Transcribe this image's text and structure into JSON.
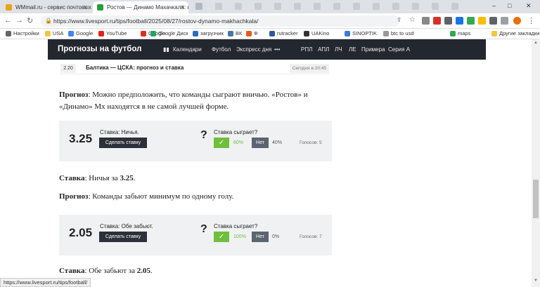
{
  "tabs": [
    {
      "title": "WMmail.ru - сервис почтовых ре",
      "color": "#e8a317"
    },
    {
      "title": "Ростов — Динамо Махачкала: пр",
      "color": "#2a9d3b"
    }
  ],
  "window_controls": [
    "–",
    "□",
    "✕"
  ],
  "address_bar": {
    "url": "https://www.livesport.ru/tips/football/2025/08/27/rostov-dynamo-makhachkala/"
  },
  "bookmarks": [
    {
      "label": "Настройки",
      "color": "#666"
    },
    {
      "label": "USA",
      "color": "#f4c542"
    },
    {
      "label": "Google",
      "color": "#4285f4"
    },
    {
      "label": "YouTube",
      "color": "#e62117"
    },
    {
      "label": "Google",
      "color": "#d93025"
    },
    {
      "label": "Google Диск",
      "color": "#1fa463"
    },
    {
      "label": "загрузчик",
      "color": "#2d6bc4"
    },
    {
      "label": "ВК",
      "color": "#4a76a8"
    },
    {
      "label": "Ф",
      "color": "#e45b1e"
    },
    {
      "label": "rutracker",
      "color": "#2c5aa0"
    },
    {
      "label": "UAKino",
      "color": "#333"
    },
    {
      "label": "SINOPTIK",
      "color": "#3a7bd5"
    },
    {
      "label": "btc to usd",
      "color": "#999"
    },
    {
      "label": "maps",
      "color": "#34a853"
    },
    {
      "label": "Другие закладки",
      "color": "#f4c542"
    }
  ],
  "header": {
    "logo": "Прогнозы на футбол",
    "nav": [
      "Календари",
      "Футбол",
      "Экспресс дня",
      "•••",
      "РПЛ",
      "АПЛ",
      "ЛЧ",
      "ЛЕ",
      "Примера",
      "Серия А"
    ]
  },
  "match": {
    "number": "2.20",
    "title": "Балтика — ЦСКА: прогноз и ставка",
    "time": "Сегодня в 20:45"
  },
  "para1": {
    "label": "Прогноз",
    "text": ": Можно предположить, что команды сыграют вничью. «Ростов» и «Динамо» Мх находятся в не самой лучшей форме."
  },
  "card1": {
    "odds": "3.25",
    "bet_label": "Ставка: Ничья.",
    "button": "Сделать ставку",
    "question": "?",
    "will_label": "Ставка сыграет?",
    "yes_icon": "✓",
    "yes_pct": "60%",
    "no_label": "Нет",
    "no_pct": "40%",
    "votes": "Голосов: 5"
  },
  "bet1": {
    "label": "Ставка",
    "text": ": Ничья за ",
    "value": "3.25",
    "end": "."
  },
  "para2": {
    "label": "Прогноз",
    "text": ": Команды забьют минимум по одному голу."
  },
  "card2": {
    "odds": "2.05",
    "bet_label": "Ставка: Обе забьют.",
    "button": "Сделать ставку",
    "question": "?",
    "will_label": "Ставка сыграет?",
    "yes_icon": "✓",
    "yes_pct": "100%",
    "no_label": "Нет",
    "no_pct": "0%",
    "votes": "Голосов: 7"
  },
  "bet2": {
    "label": "Ставка",
    "text": ": Обе забьют за ",
    "value": "2.05",
    "end": "."
  },
  "status_url": "https://www.livesport.ru/tips/football/"
}
